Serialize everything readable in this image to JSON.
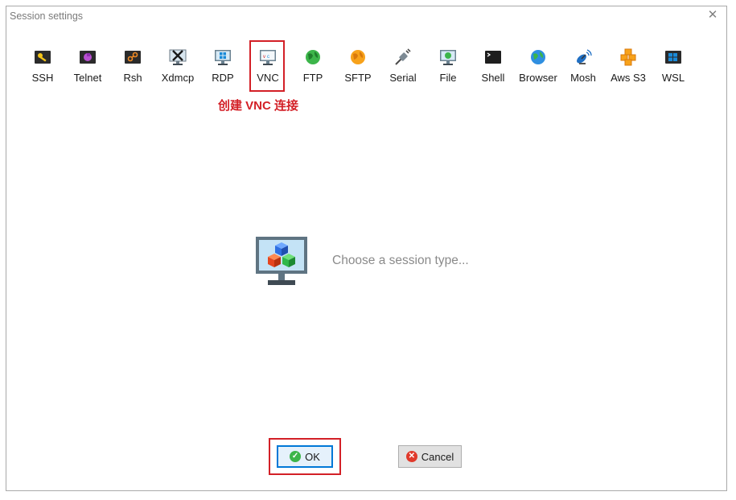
{
  "window": {
    "title": "Session settings",
    "close_glyph": "✕"
  },
  "session_types": [
    {
      "label": "SSH",
      "icon": "ssh-key-icon"
    },
    {
      "label": "Telnet",
      "icon": "telnet-icon"
    },
    {
      "label": "Rsh",
      "icon": "rsh-icon"
    },
    {
      "label": "Xdmcp",
      "icon": "xdmcp-icon"
    },
    {
      "label": "RDP",
      "icon": "rdp-monitor-icon"
    },
    {
      "label": "VNC",
      "icon": "vnc-monitor-icon"
    },
    {
      "label": "FTP",
      "icon": "ftp-globe-icon"
    },
    {
      "label": "SFTP",
      "icon": "sftp-globe-icon"
    },
    {
      "label": "Serial",
      "icon": "serial-plug-icon"
    },
    {
      "label": "File",
      "icon": "file-monitor-icon"
    },
    {
      "label": "Shell",
      "icon": "shell-terminal-icon"
    },
    {
      "label": "Browser",
      "icon": "browser-globe-icon"
    },
    {
      "label": "Mosh",
      "icon": "mosh-satellite-icon"
    },
    {
      "label": "Aws S3",
      "icon": "aws-s3-cubes-icon"
    },
    {
      "label": "WSL",
      "icon": "wsl-windows-icon"
    }
  ],
  "annotation": "创建 VNC 连接",
  "hint": "Choose a session type...",
  "buttons": {
    "ok_label": "OK",
    "cancel_label": "Cancel"
  },
  "colors": {
    "highlight_red": "#d32027",
    "ok_border": "#0078d7",
    "hint_gray": "#8a8a8a"
  }
}
